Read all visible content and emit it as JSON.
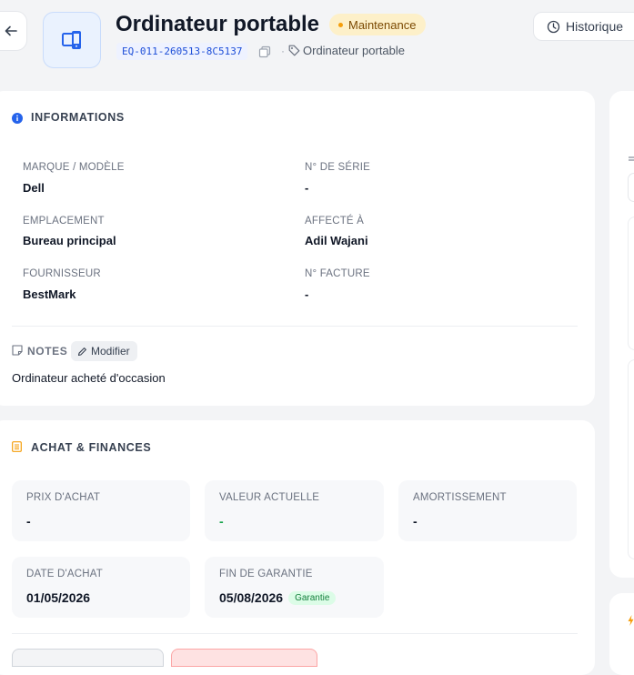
{
  "header": {
    "title": "Ordinateur portable",
    "status": "Maintenance",
    "asset_id": "EQ-011-260513-8C5137",
    "separator": "·",
    "category": "Ordinateur portable",
    "history_label": "Historique"
  },
  "informations": {
    "title": "INFORMATIONS",
    "fields": [
      {
        "label": "MARQUE / MODÈLE",
        "value": "Dell"
      },
      {
        "label": "N° DE SÉRIE",
        "value": "-"
      },
      {
        "label": "EMPLACEMENT",
        "value": "Bureau principal"
      },
      {
        "label": "AFFECTÉ À",
        "value": "Adil Wajani"
      },
      {
        "label": "FOURNISSEUR",
        "value": "BestMark"
      },
      {
        "label": "N° FACTURE",
        "value": "-"
      }
    ],
    "notes_label": "NOTES",
    "modify_label": "Modifier",
    "notes_text": "Ordinateur acheté d'occasion"
  },
  "finances": {
    "title": "ACHAT & FINANCES",
    "boxes": [
      {
        "label": "PRIX D'ACHAT",
        "value": "-"
      },
      {
        "label": "VALEUR ACTUELLE",
        "value": "-"
      },
      {
        "label": "AMORTISSEMENT",
        "value": "-"
      },
      {
        "label": "DATE D'ACHAT",
        "value": "01/05/2026"
      },
      {
        "label": "FIN DE GARANTIE",
        "value": "05/08/2026",
        "badge": "Garantie"
      }
    ]
  },
  "colors": {
    "accent": "#2563eb",
    "status_bg": "#fdf0c9",
    "status_dot": "#f59e0b",
    "positive": "#16a34a",
    "finance_icon": "#f59e0b"
  },
  "icons": [
    "back-arrow-icon",
    "laptop-phone-icon",
    "copy-icon",
    "tag-icon",
    "clock-icon",
    "info-icon",
    "note-icon",
    "pencil-icon",
    "ledger-icon",
    "lightning-icon"
  ]
}
